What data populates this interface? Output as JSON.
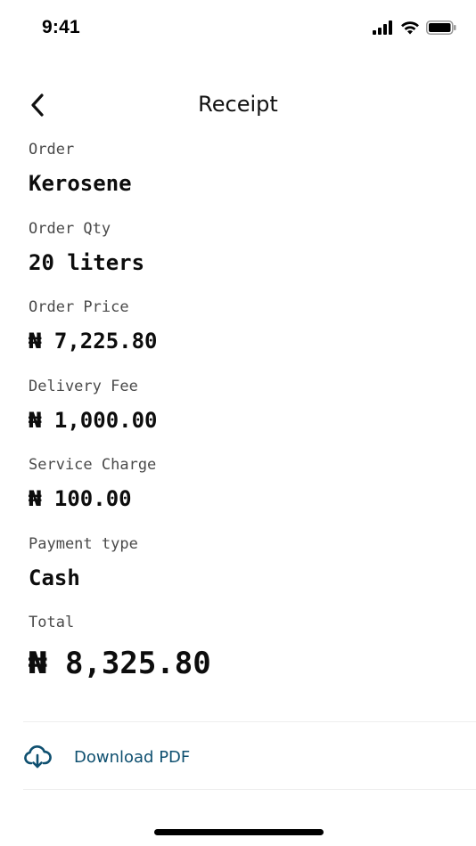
{
  "status_bar": {
    "time": "9:41"
  },
  "header": {
    "title": "Receipt",
    "back_icon": "chevron-left-icon"
  },
  "receipt": {
    "fields": [
      {
        "label": "Order",
        "value": "Kerosene"
      },
      {
        "label": "Order Qty",
        "value": "20 liters"
      },
      {
        "label": "Order Price",
        "value": "₦ 7,225.80"
      },
      {
        "label": "Delivery Fee",
        "value": "₦ 1,000.00"
      },
      {
        "label": "Service Charge",
        "value": "₦ 100.00"
      },
      {
        "label": "Payment type",
        "value": "Cash"
      }
    ],
    "total": {
      "label": "Total",
      "value": "₦ 8,325.80"
    }
  },
  "actions": {
    "download_label": "Download PDF",
    "download_icon": "cloud-download-icon"
  },
  "colors": {
    "accent": "#0f5070",
    "text": "#0d0d0d",
    "muted": "#4a4a4a"
  }
}
